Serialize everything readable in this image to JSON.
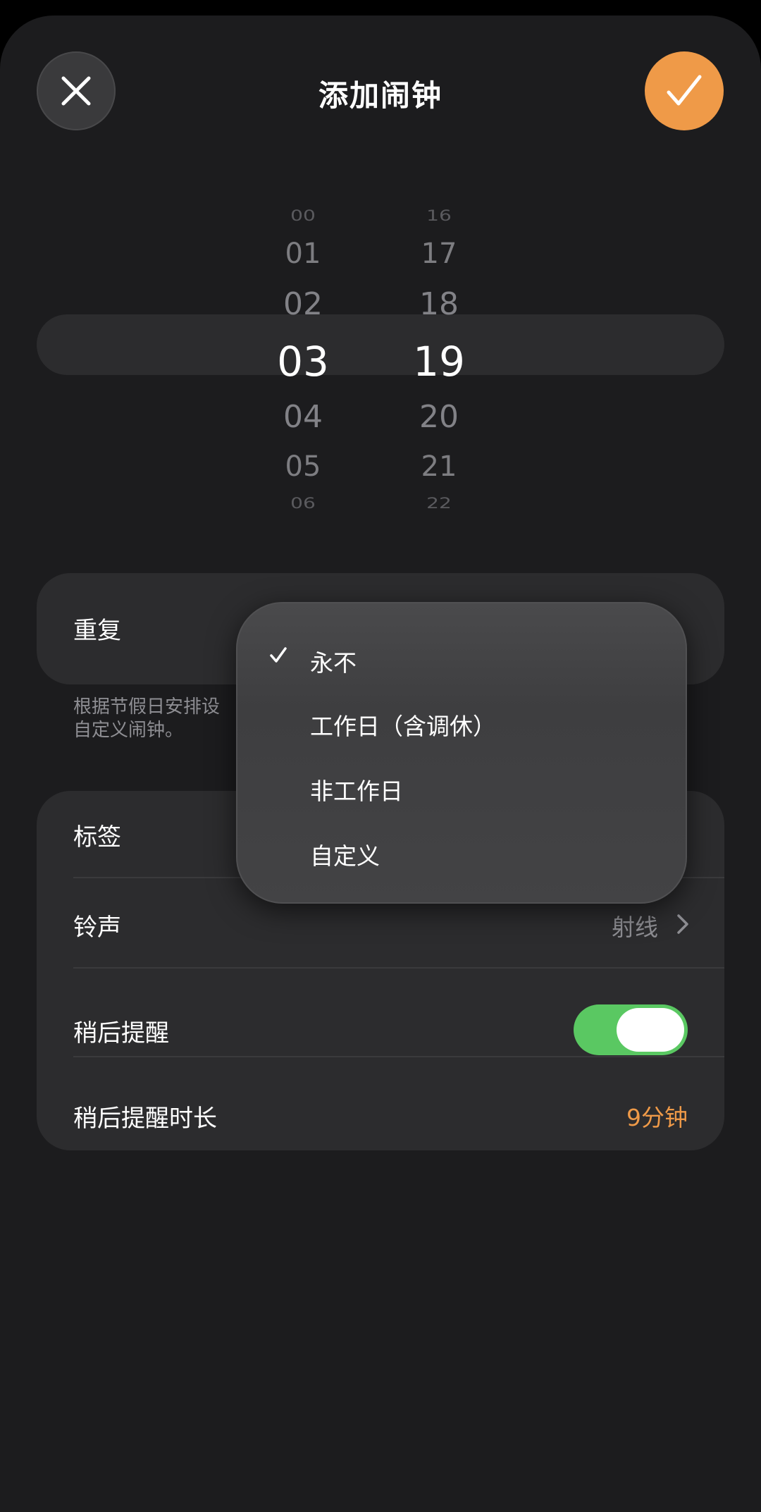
{
  "header": {
    "title": "添加闹钟",
    "close_icon": "close-icon",
    "confirm_icon": "checkmark-icon",
    "accent": "#ef9a48"
  },
  "picker": {
    "hours": [
      "00",
      "01",
      "02",
      "03",
      "04",
      "05",
      "06"
    ],
    "minutes": [
      "16",
      "17",
      "18",
      "19",
      "20",
      "21",
      "22"
    ],
    "selected_hour": "03",
    "selected_minute": "19"
  },
  "repeat": {
    "label": "重复",
    "hint": "根据节假日安排设\n自定义闹钟。"
  },
  "dropdown": {
    "items": [
      {
        "label": "永不",
        "checked": true
      },
      {
        "label": "工作日（含调休）",
        "checked": false
      },
      {
        "label": "非工作日",
        "checked": false
      },
      {
        "label": "自定义",
        "checked": false
      }
    ]
  },
  "settings": {
    "tag_label": "标签",
    "ringtone_label": "铃声",
    "ringtone_value": "射线",
    "snooze_label": "稍后提醒",
    "snooze_on": true,
    "snooze_duration_label": "稍后提醒时长",
    "snooze_duration_value": "9分钟",
    "toggle_color": "#5ac862"
  }
}
